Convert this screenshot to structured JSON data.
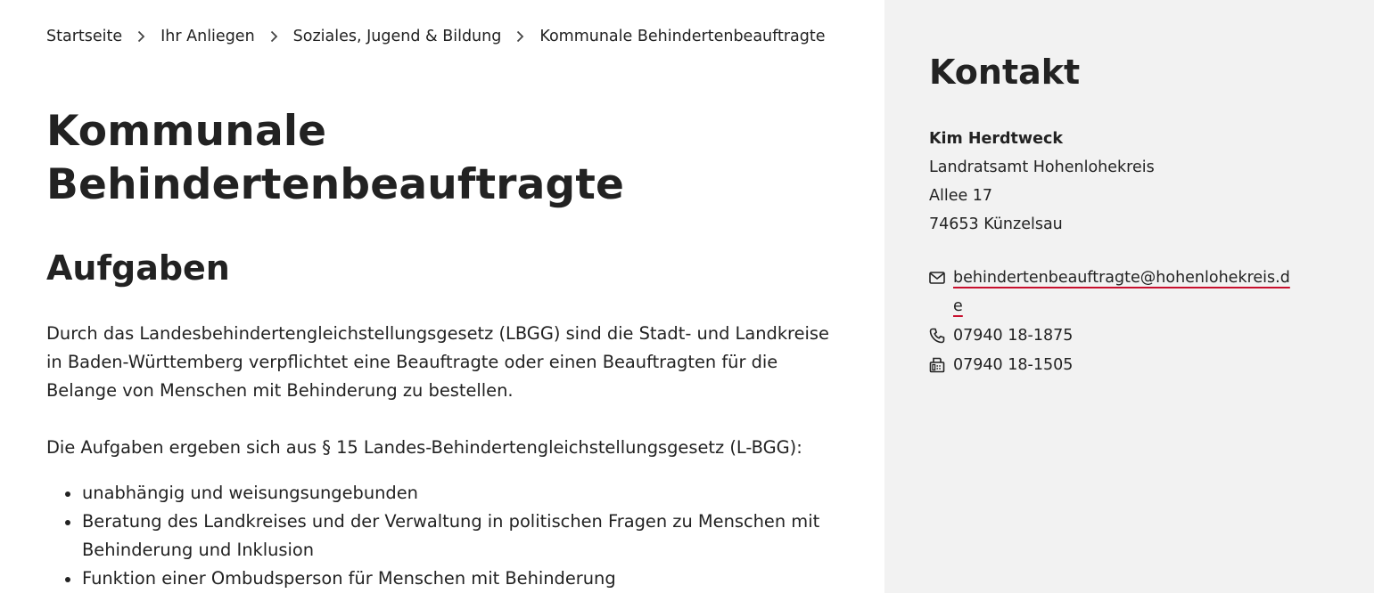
{
  "breadcrumb": [
    {
      "label": "Startseite"
    },
    {
      "label": "Ihr Anliegen"
    },
    {
      "label": "Soziales, Jugend & Bildung"
    },
    {
      "label": "Kommunale Behindertenbeauftragte"
    }
  ],
  "main": {
    "title_line1": "Kommunale",
    "title_line2": "Behindertenbeauftragte",
    "section_title": "Aufgaben",
    "paragraph1": "Durch das Landesbehindertengleichstellungsgesetz (LBGG) sind die Stadt- und Landkreise in Baden-Württemberg verpflichtet eine Beauftragte oder einen  Beauftragten für die Belange von Menschen mit Behinderung zu bestellen.",
    "paragraph2": "Die Aufgaben ergeben sich aus § 15 Landes-Behindertengleichstellungsgesetz (L-BGG):",
    "tasks": [
      "unabhängig und weisungsungebunden",
      "Beratung des Landkreises und der Verwaltung in politischen Fragen zu Menschen mit Behinderung und Inklusion",
      "Funktion einer Ombudsperson für Menschen mit Behinderung"
    ]
  },
  "contact": {
    "title": "Kontakt",
    "name": "Kim Herdtweck",
    "organization": "Landratsamt Hohenlohekreis",
    "street": "Allee 17",
    "city": "74653 Künzelsau",
    "email": "behindertenbeauftragte@hohenlohekreis.de",
    "phone": "07940 18-1875",
    "fax": "07940 18-1505",
    "icons": {
      "email": "envelope-icon",
      "phone": "phone-icon",
      "fax": "fax-icon"
    },
    "link_underline_color": "#c8102e"
  }
}
